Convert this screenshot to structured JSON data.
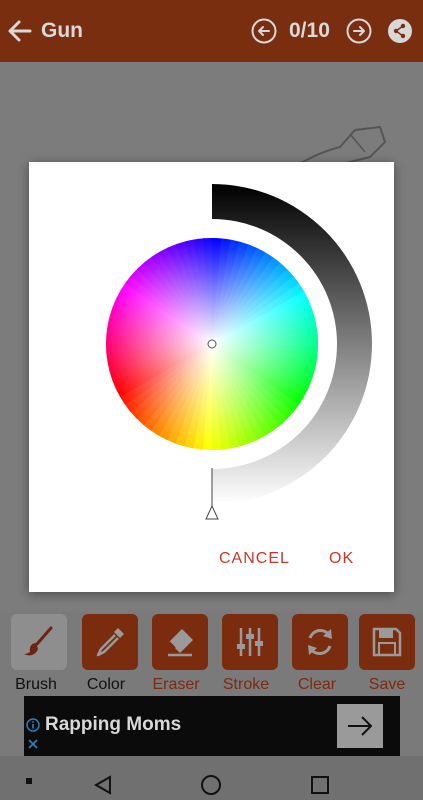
{
  "appbar": {
    "title": "Gun",
    "counter": "0/10"
  },
  "dialog": {
    "cancel_label": "CANCEL",
    "ok_label": "OK",
    "selected_value_fraction": 0.0
  },
  "toolbar": {
    "items": [
      {
        "label": "Brush",
        "icon": "brush-icon",
        "active": true
      },
      {
        "label": "Color",
        "icon": "eyedropper-icon",
        "active": false
      },
      {
        "label": "Eraser",
        "icon": "eraser-icon",
        "active": false
      },
      {
        "label": "Stroke",
        "icon": "sliders-icon",
        "active": false
      },
      {
        "label": "Clear",
        "icon": "refresh-icon",
        "active": false
      },
      {
        "label": "Save",
        "icon": "floppy-icon",
        "active": false
      }
    ]
  },
  "ad": {
    "title": "Rapping Moms"
  },
  "colors": {
    "accent_dim": "#7b2c0f",
    "dialog_button": "#c8382a"
  }
}
